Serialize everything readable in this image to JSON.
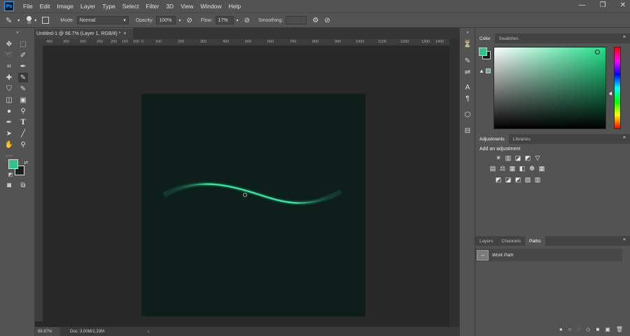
{
  "app": {
    "logo": "Ps"
  },
  "menu": [
    "File",
    "Edit",
    "Image",
    "Layer",
    "Type",
    "Select",
    "Filter",
    "3D",
    "View",
    "Window",
    "Help"
  ],
  "window_controls": [
    "—",
    "❐",
    "✕"
  ],
  "options": {
    "brush_size": "20",
    "mode_label": "Mode:",
    "mode_value": "Normal",
    "opacity_label": "Opacity:",
    "opacity_value": "100%",
    "flow_label": "Flow:",
    "flow_value": "17%",
    "smoothing_label": "Smoothing:",
    "smoothing_value": ""
  },
  "document": {
    "tab_title": "Untitled-1 @ 66.7% (Layer 1, RGB/8) *",
    "tab_close": "×",
    "ruler_ticks": [
      "400",
      "350",
      "300",
      "250",
      "200",
      "150",
      "100",
      "50",
      "0",
      "100",
      "200",
      "300",
      "400",
      "500",
      "600",
      "700",
      "800",
      "900",
      "1000",
      "1100",
      "1200",
      "1300",
      "1400"
    ],
    "canvas_color": "#0e1f1b",
    "stroke_color": "#2ee8a0"
  },
  "status": {
    "zoom": "66.67%",
    "doc_info": "Doc: 3.00M/1.20M",
    "arrow": "›"
  },
  "colors": {
    "foreground": "#2ec48a",
    "background": "#1d1d1d"
  },
  "panels": {
    "color_tabs": [
      "Color",
      "Swatches"
    ],
    "adjust_tabs": [
      "Adjustments",
      "Libraries"
    ],
    "adjust_title": "Add an adjustment",
    "adjust_icons_row1": [
      "☀",
      "▥",
      "◪",
      "◩",
      "▽"
    ],
    "adjust_icons_row2": [
      "▤",
      "⚖",
      "▦",
      "◧",
      "❁",
      "▦"
    ],
    "adjust_icons_row3": [
      "◩",
      "◪",
      "◩",
      "▨",
      "▥"
    ],
    "layer_tabs": [
      "Layers",
      "Channels",
      "Paths"
    ],
    "menu_glyph": "≡",
    "path_item": "Work Path",
    "path_footer_icons": [
      "●",
      "○",
      "◌",
      "◇",
      "■",
      "▣",
      "🗑"
    ]
  }
}
